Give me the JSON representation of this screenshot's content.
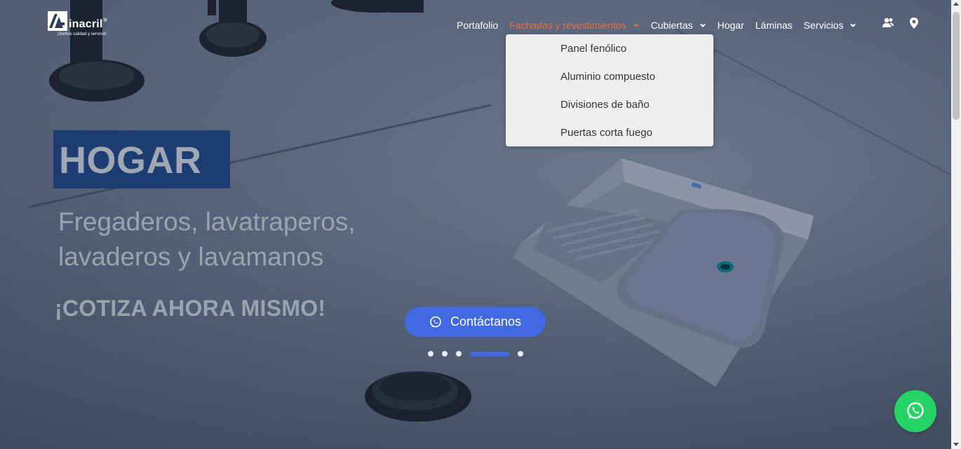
{
  "logo": {
    "word": "inacril",
    "reg": "®",
    "tagline": "¡Somos calidad y servicio!"
  },
  "nav": {
    "items": [
      {
        "label": "Portafolio",
        "dropdown": false,
        "active": false
      },
      {
        "label": "Fachadas y revestimientos",
        "dropdown": true,
        "active": true
      },
      {
        "label": "Cubiertas",
        "dropdown": true,
        "active": false
      },
      {
        "label": "Hogar",
        "dropdown": false,
        "active": false
      },
      {
        "label": "Láminas",
        "dropdown": false,
        "active": false
      },
      {
        "label": "Servicios",
        "dropdown": true,
        "active": false
      }
    ],
    "icons": [
      "users-icon",
      "location-pin-icon"
    ]
  },
  "dropdown": {
    "items": [
      {
        "label": "Panel fenólico"
      },
      {
        "label": "Aluminio compuesto"
      },
      {
        "label": "Divisiones de baño"
      },
      {
        "label": "Puertas corta fuego"
      }
    ]
  },
  "hero": {
    "title": "HOGAR",
    "subtitle_line1": "Fregaderos, lavatraperos,",
    "subtitle_line2": "lavaderos y lavamanos",
    "cta_text": "¡COTIZA AHORA MISMO!",
    "button_label": "Contáctanos"
  },
  "carousel": {
    "slides": 5,
    "active_slide": 4
  },
  "colors": {
    "accent": "#4169e1",
    "nav_active": "#ee6a3c",
    "whatsapp": "#25d366",
    "title_box": "#1d3c72"
  }
}
